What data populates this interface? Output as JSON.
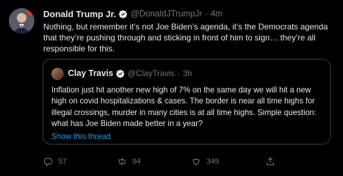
{
  "author": {
    "name": "Donald Trump Jr.",
    "handle": "@DonaldJTrumpJr",
    "time": "4m"
  },
  "tweet": {
    "text": "Nothing, but remember it’s not Joe Biden’s agenda, it’s the Democrats agenda that they’re pushing through and sticking in front of him to sign… they’re all responsible for this."
  },
  "quoted": {
    "name": "Clay Travis",
    "handle": "@ClayTravis",
    "time": "3h",
    "text": "Inflation just hit another new high of 7% on the same day we will hit a new high on covid hospitalizations & cases. The border is near all time highs for illegal crossings, murder in many cities is at all time highs. Simple question: what has Joe Biden made better in a year?",
    "link_label": "Show this thread"
  },
  "actions": {
    "replies": "57",
    "retweets": "94",
    "likes": "349"
  },
  "colors": {
    "background": "#000000",
    "text": "#e7e9ea",
    "muted": "#71767b",
    "accent": "#1d9bf0"
  },
  "icons": [
    "verified-badge-icon",
    "reply-icon",
    "retweet-icon",
    "like-icon"
  ]
}
